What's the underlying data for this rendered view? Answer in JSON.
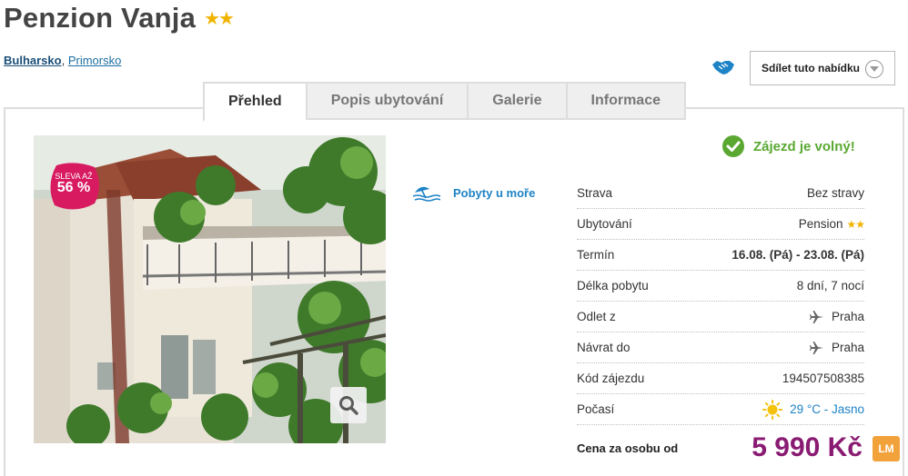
{
  "hotel": {
    "name": "Penzion Vanja",
    "stars": "★★"
  },
  "location": {
    "country": "Bulharsko",
    "separator": ",",
    "city": "Primorsko"
  },
  "share": {
    "label": "Sdílet tuto nabídku"
  },
  "tabs": [
    {
      "label": "Přehled"
    },
    {
      "label": "Popis ubytování"
    },
    {
      "label": "Galerie"
    },
    {
      "label": "Informace"
    }
  ],
  "sale": {
    "line1": "SLEVA AŽ",
    "line2": "56 %"
  },
  "category": {
    "label": "Pobyty u moře"
  },
  "availability": {
    "label": "Zájezd je volný!"
  },
  "details": [
    {
      "label": "Strava",
      "value": "Bez stravy"
    },
    {
      "label": "Ubytování",
      "value": "Pension",
      "stars": "★★"
    },
    {
      "label": "Termín",
      "value": "16.08. (Pá) - 23.08. (Pá)"
    },
    {
      "label": "Délka pobytu",
      "value": "8 dní, 7 nocí"
    },
    {
      "label": "Odlet z",
      "value": "Praha"
    },
    {
      "label": "Návrat do",
      "value": "Praha"
    },
    {
      "label": "Kód zájezdu",
      "value": "194507508385"
    },
    {
      "label": "Počasí",
      "value": "29 °C - Jasno"
    }
  ],
  "price": {
    "label": "Cena za osobu od",
    "value": "5 990 Kč",
    "badge": "LM"
  },
  "colors": {
    "link": "#1d6fa0",
    "accent_blue": "#1d83c6",
    "available_green": "#5aa832",
    "price_purple": "#8a1b72",
    "star_gold": "#f0b400",
    "sale_pink": "#d81b60",
    "lm_orange": "#f2a23a"
  }
}
